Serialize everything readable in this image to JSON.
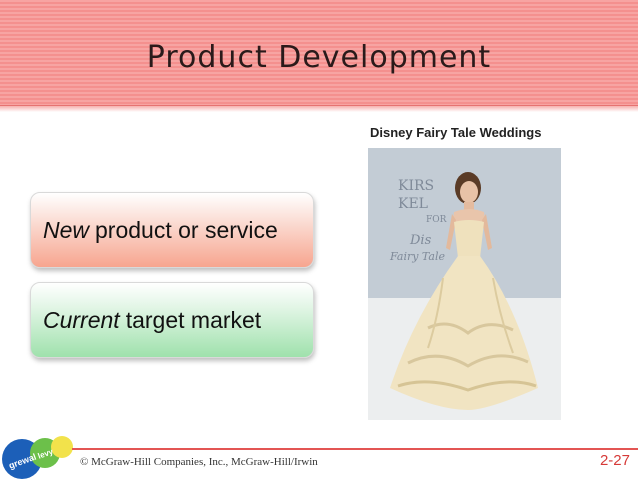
{
  "slide": {
    "title": "Product Development",
    "photo_caption": "Disney Fairy Tale Weddings",
    "boxes": [
      {
        "emphasis": "New",
        "rest": "product or service"
      },
      {
        "emphasis": "Current",
        "rest": "target market"
      }
    ],
    "photo_sign": [
      "KIRS",
      "KEL",
      "FOR",
      "Dis",
      "Fairy Tale"
    ],
    "footer": "© McGraw-Hill Companies, Inc., McGraw-Hill/Irwin",
    "page_number": "2-27",
    "logo_labels": [
      "grewal",
      "levy"
    ]
  },
  "colors": {
    "header": "#f4908e",
    "box_new": "#f7a58f",
    "box_current": "#9fe1ac",
    "page_number": "#d63a38"
  }
}
